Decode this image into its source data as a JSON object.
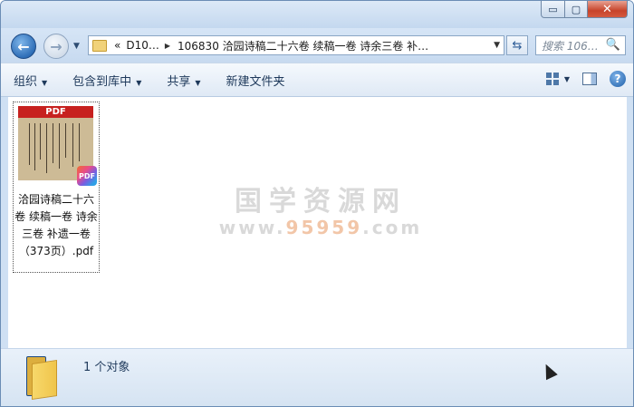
{
  "window_controls": {
    "minimize": "▭",
    "maximize": "▢",
    "close": "✕"
  },
  "nav": {
    "address": {
      "chevrons": "«",
      "seg1": "D10…",
      "seg2": "106830 洽园诗稿二十六卷 续稿一卷 诗余三卷 补…"
    },
    "search_placeholder": "搜索 106…",
    "search_icon": "🔍"
  },
  "toolbar": {
    "organize": "组织",
    "include_in_library": "包含到库中",
    "share": "共享",
    "new_folder": "新建文件夹"
  },
  "file": {
    "thumb_label": "PDF",
    "badge_label": "PDF",
    "name": "洽园诗稿二十六卷 续稿一卷 诗余三卷 补遗一卷（373页）.pdf"
  },
  "watermark": {
    "line1": "国学资源网",
    "line2_prefix": "www.",
    "line2_num": "95959",
    "line2_suffix": ".com"
  },
  "status": {
    "count": "1 个对象"
  },
  "icons": {
    "back": "arrow-left-icon",
    "forward": "arrow-right-icon",
    "refresh": "refresh-icon",
    "views": "view-grid-icon",
    "preview_pane": "preview-pane-icon",
    "help": "help-icon"
  }
}
